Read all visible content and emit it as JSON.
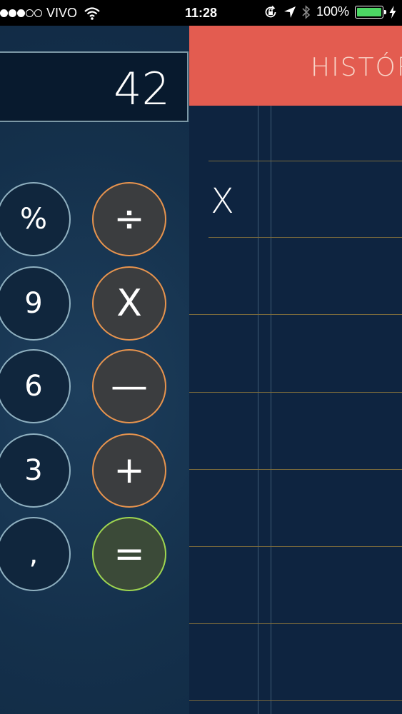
{
  "status": {
    "carrier": "VIVO",
    "time": "11:28",
    "battery": "100%",
    "battery_level": 1.0
  },
  "display": {
    "value": "42"
  },
  "keys": {
    "percent": "%",
    "nine": "9",
    "six": "6",
    "three": "3",
    "comma": ",",
    "divide": "÷",
    "multiply": "X",
    "minus": "—",
    "plus": "+",
    "equals": "="
  },
  "history": {
    "title": "HISTÓRICO",
    "entry_operator": "X"
  }
}
